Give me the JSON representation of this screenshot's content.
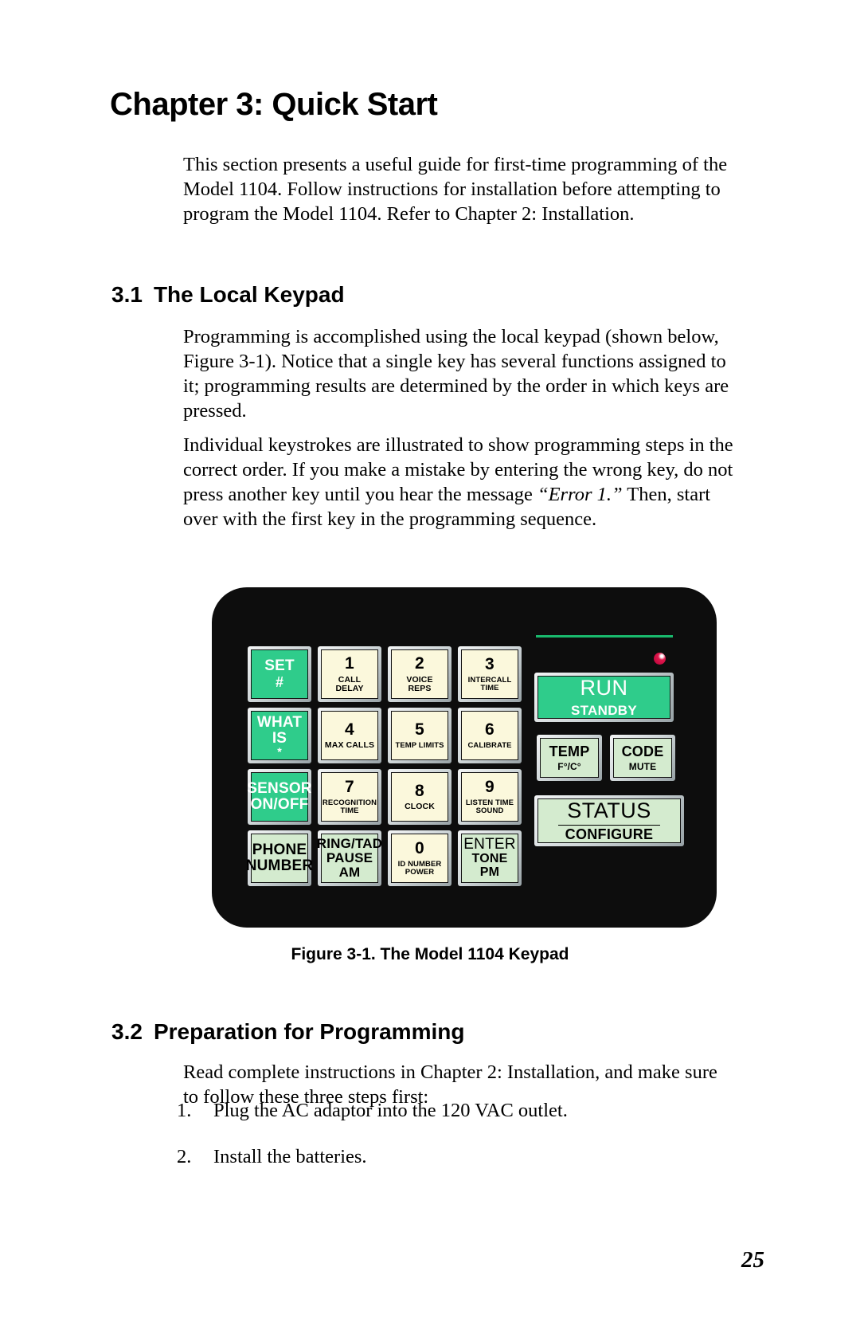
{
  "document": {
    "chapter_title": "Chapter 3: Quick Start",
    "page_number": "25"
  },
  "intro_paragraph": "This section presents a useful guide for first-time programming of the Model 1104. Follow instructions for installation before attempting to program the Model 1104. Refer to Chapter 2: Installation.",
  "sections": [
    {
      "number": "3.1",
      "title": "The Local Keypad",
      "paragraphs": [
        "Programming is accomplished using the local keypad (shown below, Figure 3-1). Notice that a single key has several functions assigned to it; programming results are determined by the order in which keys are pressed.",
        "Individual keystrokes are illustrated to show programming steps in the correct order. If you make a mistake by entering the wrong key, do not press another key until you hear the message "
      ],
      "emphasis_text": "“Error 1.”",
      "paragraph2_tail": " Then, start over with the first key in the programming sequence."
    },
    {
      "number": "3.2",
      "title": "Preparation for Programming",
      "paragraphs": [
        "Read complete instructions in Chapter 2: Installation, and make sure to follow these three steps first:"
      ],
      "list": [
        {
          "marker": "1.",
          "text": "Plug the AC adaptor into the 120 VAC outlet."
        },
        {
          "marker": "2.",
          "text": "Install the batteries."
        }
      ]
    }
  ],
  "figure": {
    "caption": "Figure 3-1.  The Model 1104 Keypad",
    "colors": {
      "bezel": "#0d0d0d",
      "key_cream": "#fbf8dc",
      "key_green": "#2fcc8b",
      "key_mint": "#d4ebcf",
      "led": "#e0184c",
      "green_bar": "#19b96d"
    },
    "keypad": {
      "grid": [
        [
          {
            "main": "SET",
            "symbol": "#",
            "style": "green"
          },
          {
            "main": "1",
            "sub": "CALL\nDELAY",
            "style": "cream"
          },
          {
            "main": "2",
            "sub": "VOICE\nREPS",
            "style": "cream"
          },
          {
            "main": "3",
            "sub": "INTERCALL\nTIME",
            "style": "cream"
          }
        ],
        [
          {
            "main": "WHAT",
            "main2": "IS",
            "symbol": "*",
            "style": "green"
          },
          {
            "main": "4",
            "sub": "MAX CALLS",
            "style": "cream"
          },
          {
            "main": "5",
            "sub": "TEMP LIMITS",
            "style": "cream"
          },
          {
            "main": "6",
            "sub": "CALIBRATE",
            "style": "cream"
          }
        ],
        [
          {
            "main": "SENSOR",
            "main2": "ON/OFF",
            "style": "green"
          },
          {
            "main": "7",
            "sub": "RECOGNITION\nTIME",
            "style": "cream"
          },
          {
            "main": "8",
            "sub": "CLOCK",
            "style": "cream"
          },
          {
            "main": "9",
            "sub": "LISTEN TIME\nSOUND",
            "style": "cream"
          }
        ],
        [
          {
            "main": "PHONE",
            "main2": "NUMBER",
            "style": "mint"
          },
          {
            "main": "RING/TAD",
            "main2": "PAUSE",
            "main3": "AM",
            "style": "mint"
          },
          {
            "main": "0",
            "sub": "ID NUMBER\nPOWER",
            "style": "cream"
          },
          {
            "main": "ENTER",
            "main2": "TONE",
            "main3": "PM",
            "style": "mint"
          }
        ]
      ],
      "right_cluster": {
        "run": {
          "main": "RUN",
          "sub": "STANDBY",
          "style": "green"
        },
        "temp": {
          "main": "TEMP",
          "sub": "F°/C°",
          "style": "mint"
        },
        "code": {
          "main": "CODE",
          "sub": "MUTE",
          "style": "mint"
        },
        "status": {
          "main": "STATUS",
          "sub": "CONFIGURE",
          "style": "mint"
        }
      }
    }
  }
}
